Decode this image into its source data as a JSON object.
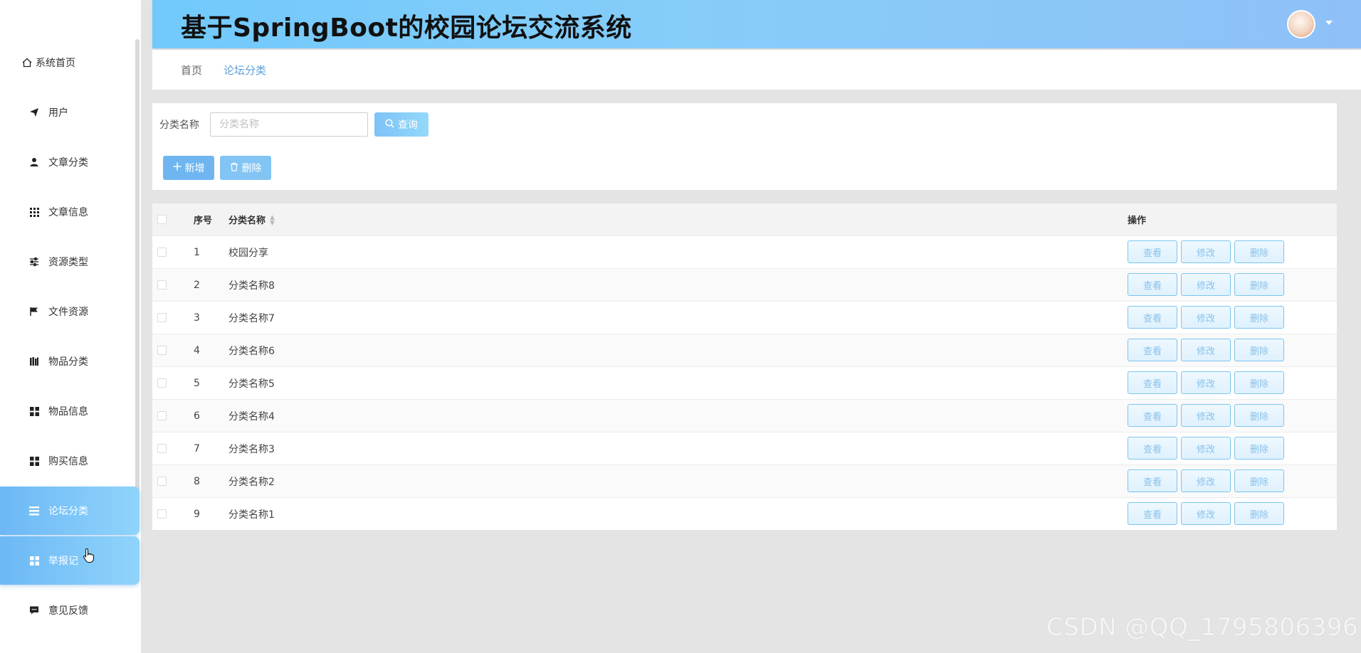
{
  "header": {
    "title": "基于SpringBoot的校园论坛交流系统"
  },
  "sidebar": {
    "items": [
      {
        "label": "系统首页",
        "icon": "home-icon"
      },
      {
        "label": "用户",
        "icon": "send-icon"
      },
      {
        "label": "文章分类",
        "icon": "user-icon"
      },
      {
        "label": "文章信息",
        "icon": "grid-icon"
      },
      {
        "label": "资源类型",
        "icon": "sliders-icon"
      },
      {
        "label": "文件资源",
        "icon": "flag-icon"
      },
      {
        "label": "物品分类",
        "icon": "books-icon"
      },
      {
        "label": "物品信息",
        "icon": "apps-icon"
      },
      {
        "label": "购买信息",
        "icon": "apps-icon"
      },
      {
        "label": "论坛分类",
        "icon": "menu-icon"
      },
      {
        "label": "举报记",
        "icon": "apps-icon"
      },
      {
        "label": "意见反馈",
        "icon": "comment-icon"
      }
    ]
  },
  "breadcrumb": {
    "home": "首页",
    "current": "论坛分类"
  },
  "search": {
    "label": "分类名称",
    "placeholder": "分类名称",
    "query_label": "查询"
  },
  "actions": {
    "add_label": "新增",
    "delete_label": "删除"
  },
  "table": {
    "headers": {
      "seq": "序号",
      "name": "分类名称",
      "op": "操作"
    },
    "op_labels": {
      "view": "查看",
      "edit": "修改",
      "delete": "删除"
    },
    "rows": [
      {
        "seq": "1",
        "name": "校园分享"
      },
      {
        "seq": "2",
        "name": "分类名称8"
      },
      {
        "seq": "3",
        "name": "分类名称7"
      },
      {
        "seq": "4",
        "name": "分类名称6"
      },
      {
        "seq": "5",
        "name": "分类名称5"
      },
      {
        "seq": "6",
        "name": "分类名称4"
      },
      {
        "seq": "7",
        "name": "分类名称3"
      },
      {
        "seq": "8",
        "name": "分类名称2"
      },
      {
        "seq": "9",
        "name": "分类名称1"
      }
    ]
  },
  "watermark": "CSDN @QQ_1795806396"
}
